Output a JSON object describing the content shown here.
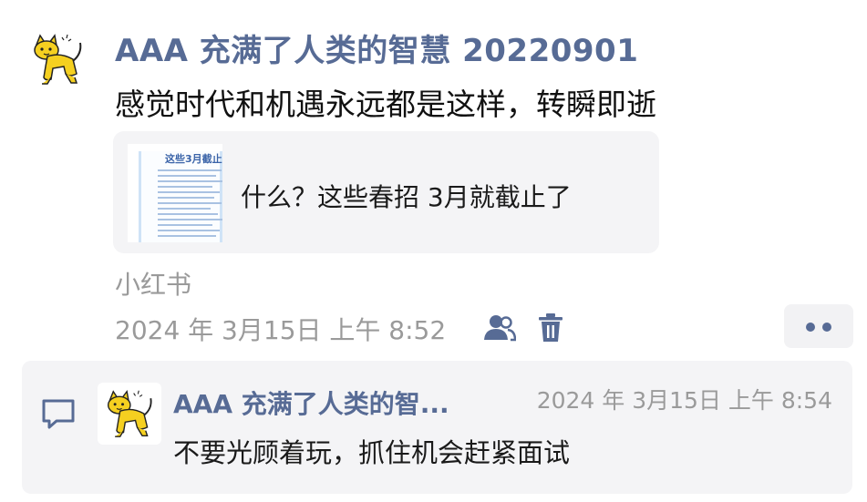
{
  "post": {
    "author": "AAA 充满了人类的智慧 20220901",
    "text": "感觉时代和机遇永远都是这样，转瞬即逝",
    "avatar_icon": "cat-icon",
    "link_card": {
      "thumbnail_title": "这些3月截止",
      "title": "什么？这些春招 3月就截止了"
    },
    "source": "小红书",
    "timestamp": "2024 年 3月15日 上午 8:52",
    "friends_icon": "friends-icon",
    "delete_icon": "trash-icon",
    "more_icon": "more-dots-icon"
  },
  "comments": [
    {
      "author": "AAA 充满了人类的智...",
      "time": "2024 年 3月15日 上午 8:54",
      "text": "不要光顾着玩，抓住机会赶紧面试",
      "avatar_icon": "cat-icon"
    }
  ],
  "colors": {
    "author_link": "#576b95",
    "meta_gray": "#9a9a9a",
    "card_bg": "#f4f4f6"
  }
}
